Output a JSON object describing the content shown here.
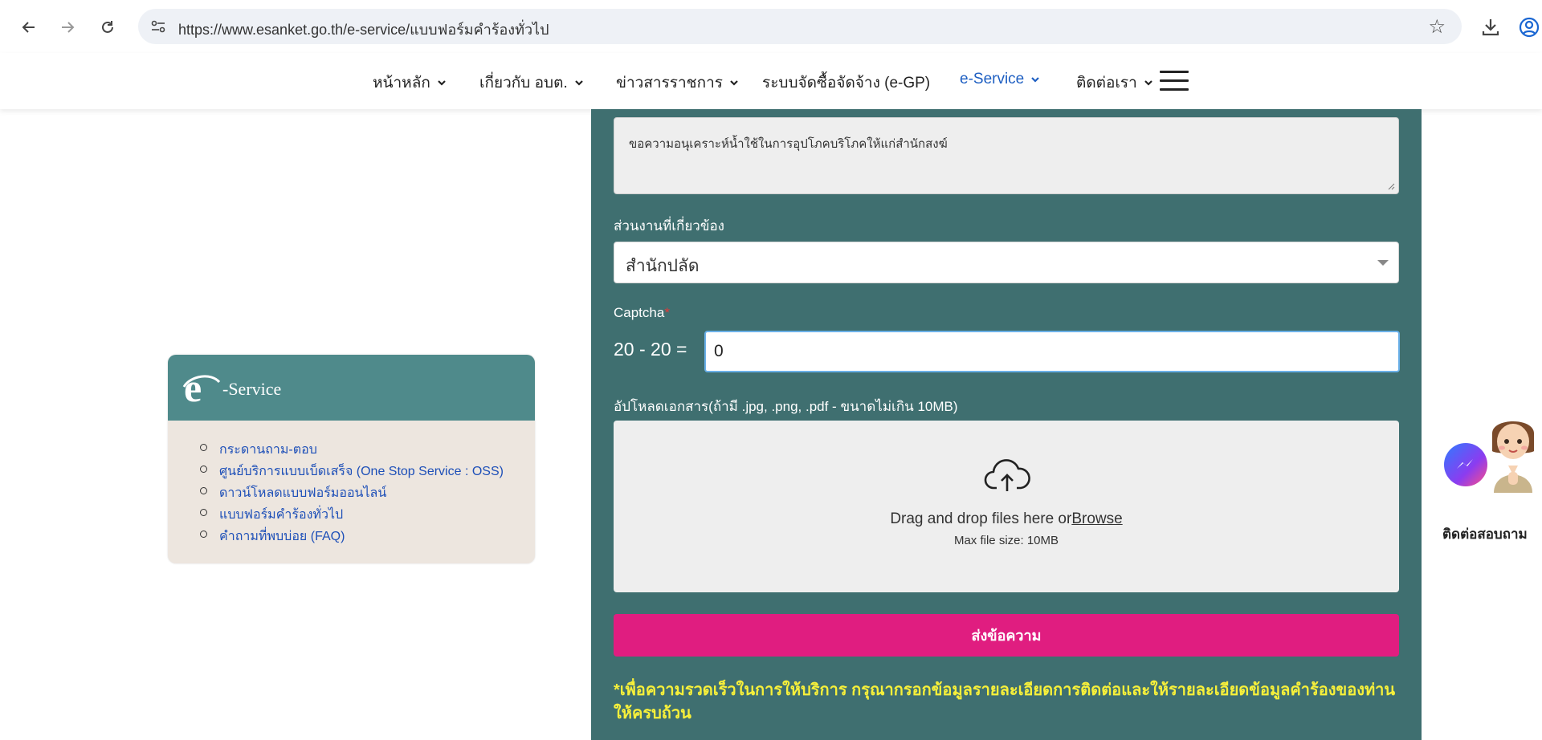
{
  "browser": {
    "url": "https://www.esanket.go.th/e-service/แบบฟอร์มคำร้องทั่วไป"
  },
  "nav": {
    "items": [
      {
        "label": "หน้าหลัก",
        "has_dropdown": true
      },
      {
        "label": "เกี่ยวกับ อบต.",
        "has_dropdown": true
      },
      {
        "label": "ข่าวสารราชการ",
        "has_dropdown": true
      },
      {
        "label": "ระบบจัดซื้อจัดจ้าง (e-GP)",
        "has_dropdown": false
      },
      {
        "label": "e-Service",
        "has_dropdown": true,
        "active": true
      },
      {
        "label": "ติดต่อเรา",
        "has_dropdown": true
      }
    ],
    "active_color": "#1e5fc2"
  },
  "form": {
    "message_text": "ขอความอนุเคราะห์น้ำใช้ในการอุปโภคบริโภคให้แก่สำนักสงฆ์",
    "department_label": "ส่วนงานที่เกี่ยวข้อง",
    "department_value": "สำนักปลัด",
    "captcha_label": "Captcha",
    "captcha_required_mark": "*",
    "captcha_question": "20 - 20 =",
    "captcha_value": "0",
    "upload_label": "อัปโหลดเอกสาร(ถ้ามี .jpg, .png, .pdf - ขนาดไม่เกิน 10MB)",
    "dropzone_text": "Drag and drop files here or",
    "dropzone_browse": "Browse",
    "dropzone_size": "Max file size: 10MB",
    "submit_label": "ส่งข้อความ",
    "note": "*เพื่อความรวดเร็วในการให้บริการ กรุณากรอกข้อมูลรายละเอียดการติดต่อและให้รายละเอียดข้อมูลคำร้องของท่านให้ครบถ้วน",
    "panel_color": "#3f6f70",
    "submit_color": "#e01d80",
    "note_color": "#f7f03a"
  },
  "sidebar_card": {
    "title": "-Service",
    "links": [
      "กระดานถาม-ตอบ",
      "ศูนย์บริการแบบเบ็ดเสร็จ (One Stop Service : OSS)",
      "ดาวน์โหลดแบบฟอร์มออนไลน์",
      "แบบฟอร์มคำร้องทั่วไป",
      "คำถามที่พบบ่อย (FAQ)"
    ],
    "header_color": "#4f8a8b",
    "body_color": "#ede6df"
  },
  "widget": {
    "label": "ติดต่อสอบถาม",
    "icons": [
      "messenger-icon",
      "mascot-image"
    ]
  }
}
